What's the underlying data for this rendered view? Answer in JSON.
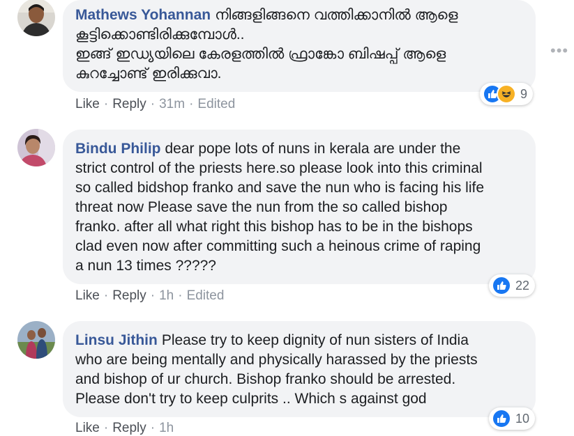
{
  "comments": [
    {
      "author": "Mathews Yohannan",
      "text": "നിങ്ങളിങ്ങനെ വത്തിക്കാനിൽ ആളെ\nകൂട്ടിക്കൊണ്ടിരിക്കുമ്പോൾ..\nഇങ്ങ് ഇഡ്യയിലെ കേരളത്തിൽ ഫ്രാങ്കോ ബിഷപ്പ് ആളെ\nകുറച്ചോണ്ട് ഇരിക്കുവാ.",
      "like": "Like",
      "reply": "Reply",
      "time": "31m",
      "edited": "Edited",
      "reaction_count": "9",
      "reactions": [
        "like-icon",
        "haha-icon"
      ]
    },
    {
      "author": "Bindu Philip",
      "text": "dear pope lots of nuns in kerala are under the\nstrict control of the priests here.so please look into this criminal\nso called bidshop franko and save the nun who is facing his life\nthreat now Please save the nun from the so called bishop\nfranko. after all what right this bishop has to be in the bishops\nclad even now after committing such a heinous crime of raping\na nun 13 times ?????",
      "like": "Like",
      "reply": "Reply",
      "time": "1h",
      "edited": "Edited",
      "reaction_count": "22",
      "reactions": [
        "like-icon"
      ]
    },
    {
      "author": "Linsu Jithin",
      "text": "Please try to keep dignity of nun sisters of India\nwho are being mentally and physically harassed by the priests\nand bishop of ur church. Bishop franko should be arrested.\nPlease don't try to keep culprits .. Which s against god",
      "like": "Like",
      "reply": "Reply",
      "time": "1h",
      "edited": "",
      "reaction_count": "10",
      "reactions": [
        "like-icon"
      ]
    }
  ],
  "more_label": "•••",
  "colors": {
    "author": "#385898",
    "bubble": "#f2f3f5",
    "like_reaction": "#1877f2",
    "haha_reaction": "#f7b125"
  }
}
